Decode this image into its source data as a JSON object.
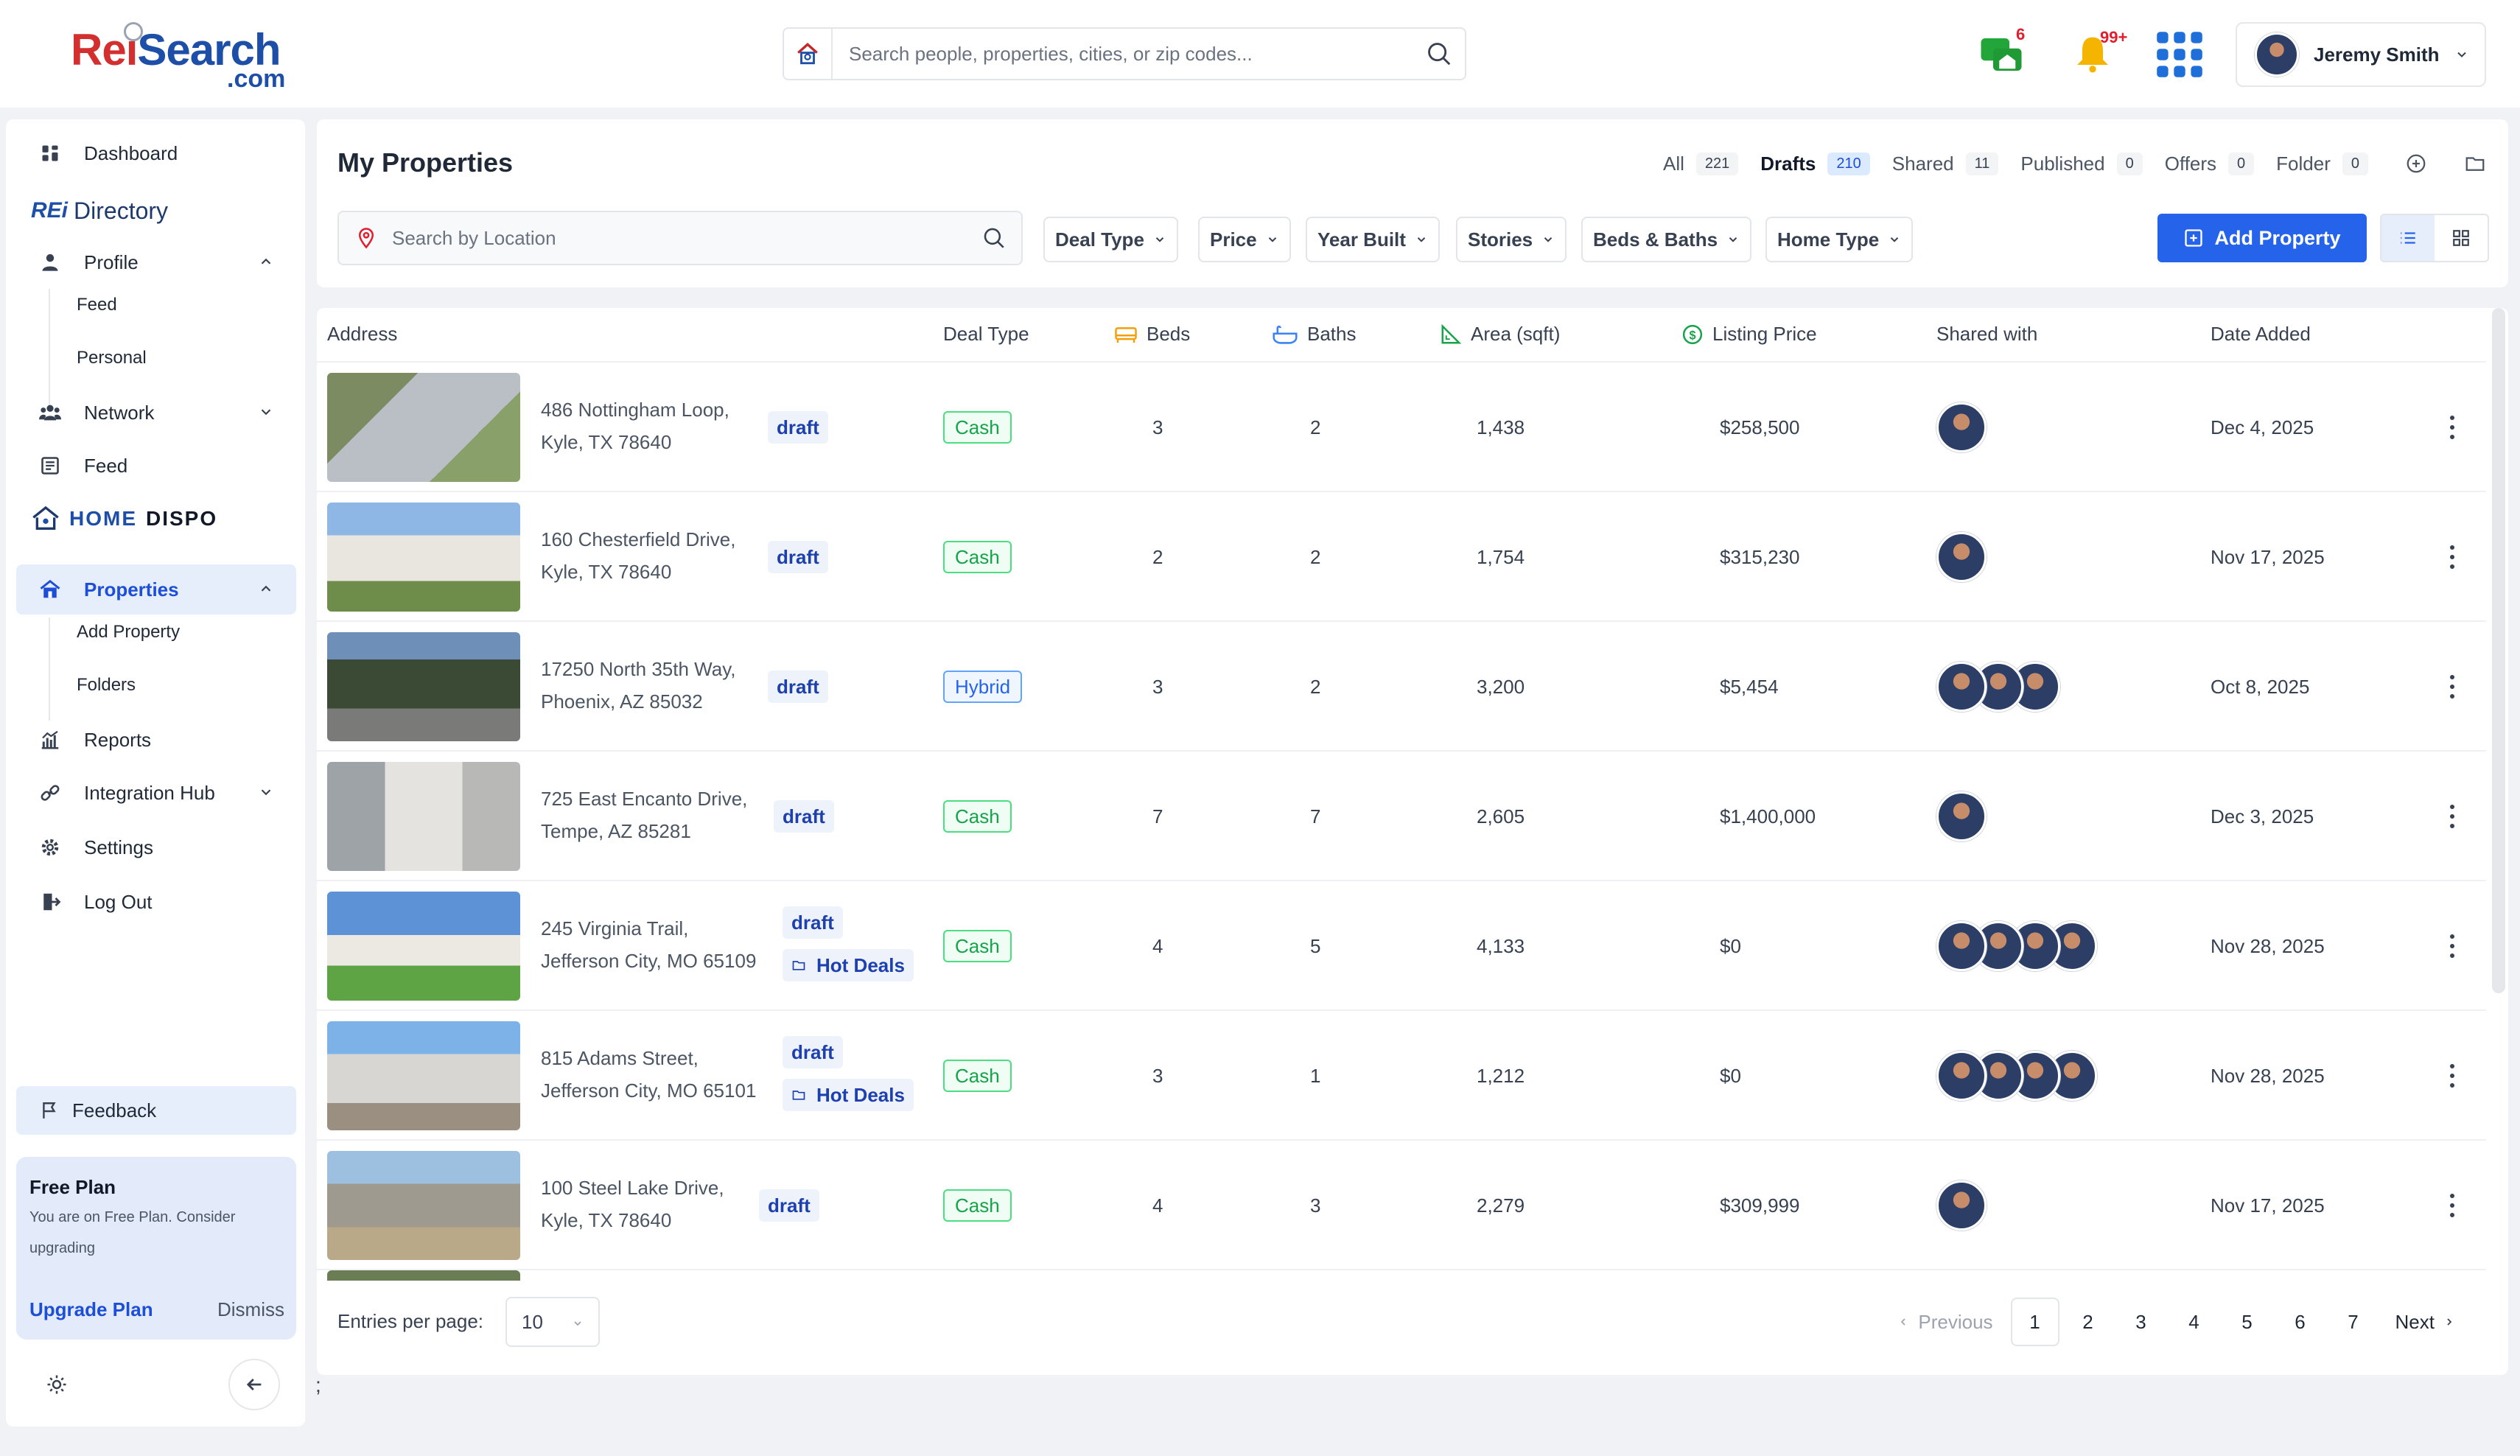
{
  "header": {
    "logo_main": "ReiSearch",
    "logo_suffix": ".com",
    "search_placeholder": "Search people, properties, cities, or zip codes...",
    "messages_count": "6",
    "notifications_count": "99+",
    "user_name": "Jeremy Smith"
  },
  "sidebar": {
    "dashboard": "Dashboard",
    "rei_directory_prefix": "REi",
    "rei_directory_label": "Directory",
    "profile": "Profile",
    "profile_sub": [
      "Feed",
      "Personal"
    ],
    "network": "Network",
    "feed": "Feed",
    "home_dispo_a": "HOME",
    "home_dispo_b": "DISPO",
    "properties": "Properties",
    "properties_sub": [
      "Add Property",
      "Folders"
    ],
    "reports": "Reports",
    "integration_hub": "Integration Hub",
    "settings": "Settings",
    "logout": "Log Out",
    "feedback": "Feedback",
    "plan_title": "Free Plan",
    "plan_desc": "You are on Free Plan. Consider upgrading",
    "upgrade": "Upgrade Plan",
    "dismiss": "Dismiss"
  },
  "main": {
    "title": "My Properties",
    "tabs": [
      {
        "label": "All",
        "count": "221"
      },
      {
        "label": "Drafts",
        "count": "210"
      },
      {
        "label": "Shared",
        "count": "11"
      },
      {
        "label": "Published",
        "count": "0"
      },
      {
        "label": "Offers",
        "count": "0"
      },
      {
        "label": "Folder",
        "count": "0"
      }
    ],
    "location_placeholder": "Search by Location",
    "filters": [
      "Deal Type",
      "Price",
      "Year Built",
      "Stories",
      "Beds & Baths",
      "Home Type"
    ],
    "add_property": "Add Property"
  },
  "table": {
    "headers": {
      "address": "Address",
      "deal_type": "Deal Type",
      "beds": "Beds",
      "baths": "Baths",
      "area": "Area (sqft)",
      "price": "Listing Price",
      "shared": "Shared with",
      "date": "Date Added"
    },
    "rows": [
      {
        "line1": "486 Nottingham Loop,",
        "line2": "Kyle, TX 78640",
        "status": "draft",
        "folder": "",
        "deal": "Cash",
        "beds": "3",
        "baths": "2",
        "area": "1,438",
        "price": "$258,500",
        "shared_count": 1,
        "date": "Dec 4, 2025"
      },
      {
        "line1": "160 Chesterfield Drive,",
        "line2": "Kyle, TX 78640",
        "status": "draft",
        "folder": "",
        "deal": "Cash",
        "beds": "2",
        "baths": "2",
        "area": "1,754",
        "price": "$315,230",
        "shared_count": 1,
        "date": "Nov 17, 2025"
      },
      {
        "line1": "17250 North 35th Way,",
        "line2": "Phoenix, AZ 85032",
        "status": "draft",
        "folder": "",
        "deal": "Hybrid",
        "beds": "3",
        "baths": "2",
        "area": "3,200",
        "price": "$5,454",
        "shared_count": 3,
        "date": "Oct 8, 2025"
      },
      {
        "line1": "725 East Encanto Drive,",
        "line2": "Tempe, AZ 85281",
        "status": "draft",
        "folder": "",
        "deal": "Cash",
        "beds": "7",
        "baths": "7",
        "area": "2,605",
        "price": "$1,400,000",
        "shared_count": 1,
        "date": "Dec 3, 2025"
      },
      {
        "line1": "245 Virginia Trail,",
        "line2": "Jefferson City, MO 65109",
        "status": "draft",
        "folder": "Hot Deals",
        "deal": "Cash",
        "beds": "4",
        "baths": "5",
        "area": "4,133",
        "price": "$0",
        "shared_count": 4,
        "date": "Nov 28, 2025"
      },
      {
        "line1": "815 Adams Street,",
        "line2": "Jefferson City, MO 65101",
        "status": "draft",
        "folder": "Hot Deals",
        "deal": "Cash",
        "beds": "3",
        "baths": "1",
        "area": "1,212",
        "price": "$0",
        "shared_count": 4,
        "date": "Nov 28, 2025"
      },
      {
        "line1": "100 Steel Lake Drive,",
        "line2": "Kyle, TX 78640",
        "status": "draft",
        "folder": "",
        "deal": "Cash",
        "beds": "4",
        "baths": "3",
        "area": "2,279",
        "price": "$309,999",
        "shared_count": 1,
        "date": "Nov 17, 2025"
      }
    ]
  },
  "footer": {
    "entries_label": "Entries per page:",
    "entries_value": "10",
    "previous": "Previous",
    "pages": [
      "1",
      "2",
      "3",
      "4",
      "5",
      "6",
      "7"
    ],
    "next": "Next",
    "trailing": ";"
  },
  "colors": {
    "accent": "#2563eb",
    "cash": "#16a34a",
    "hybrid": "#2563eb",
    "alert": "#e11d2e"
  }
}
